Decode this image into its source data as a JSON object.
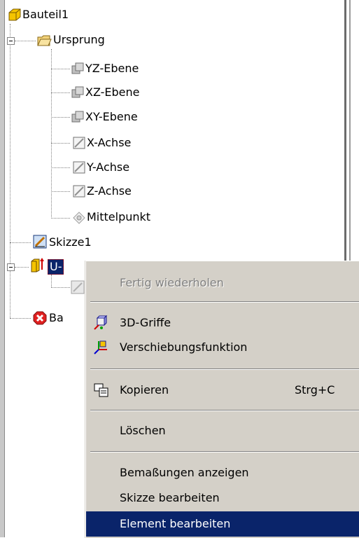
{
  "tree": {
    "root": "Bauteil1",
    "origin": "Ursprung",
    "origin_items": [
      "YZ-Ebene",
      "XZ-Ebene",
      "XY-Ebene",
      "X-Achse",
      "Y-Achse",
      "Z-Achse",
      "Mittelpunkt"
    ],
    "sketch": "Skizze1",
    "feature_partial": "U-",
    "end_partial": "Ba"
  },
  "menu": {
    "repeat": "Fertig wiederholen",
    "grips": "3D-Griffe",
    "move": "Verschiebungsfunktion",
    "copy": "Kopieren",
    "copy_shortcut": "Strg+C",
    "delete": "Löschen",
    "show_dims": "Bemaßungen anzeigen",
    "edit_sketch": "Skizze bearbeiten",
    "edit_feature": "Element bearbeiten"
  },
  "colors": {
    "menu_bg": "#d4d0c8",
    "highlight": "#0a246a"
  }
}
